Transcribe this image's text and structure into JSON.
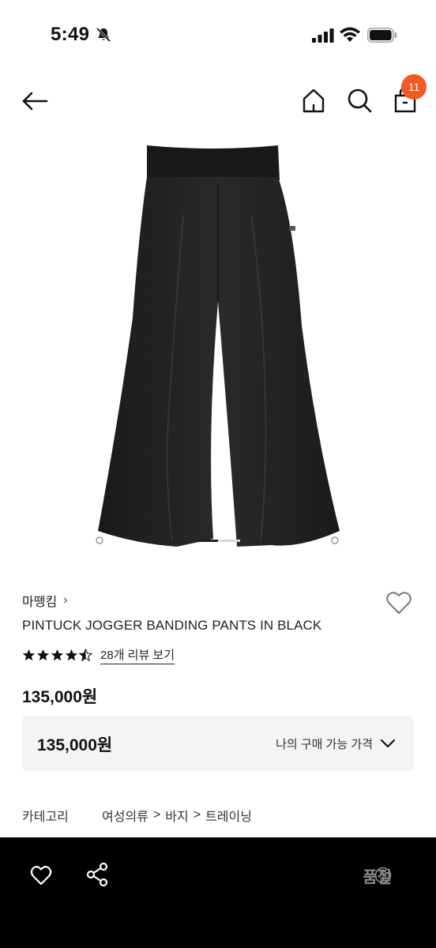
{
  "status_bar": {
    "time": "5:49"
  },
  "nav": {
    "cart_count": "11"
  },
  "product": {
    "brand": "마뗑킴",
    "brand_chevron": "›",
    "title": "PINTUCK JOGGER BANDING PANTS IN BLACK",
    "rating": 4.5,
    "review_link": "28개 리뷰 보기",
    "price": "135,000원"
  },
  "price_box": {
    "value": "135,000원",
    "label": "나의 구매 가능 가격"
  },
  "category": {
    "label": "카테고리",
    "path": [
      "여성의류",
      "바지",
      "트레이닝"
    ],
    "separator": ">"
  },
  "bottom_bar": {
    "status": "품절"
  },
  "carousel": {
    "active_index": 0,
    "count": 2
  },
  "colors": {
    "badge": "#f15a24",
    "bottom_bar": "#000000",
    "price_box_bg": "#f4f4f4"
  },
  "icons": [
    "bell-muted-icon",
    "signal-icon",
    "wifi-icon",
    "battery-icon",
    "back-arrow-icon",
    "home-icon",
    "search-icon",
    "cart-icon",
    "heart-icon",
    "star-icon",
    "chevron-down-icon",
    "share-icon",
    "help-icon"
  ]
}
